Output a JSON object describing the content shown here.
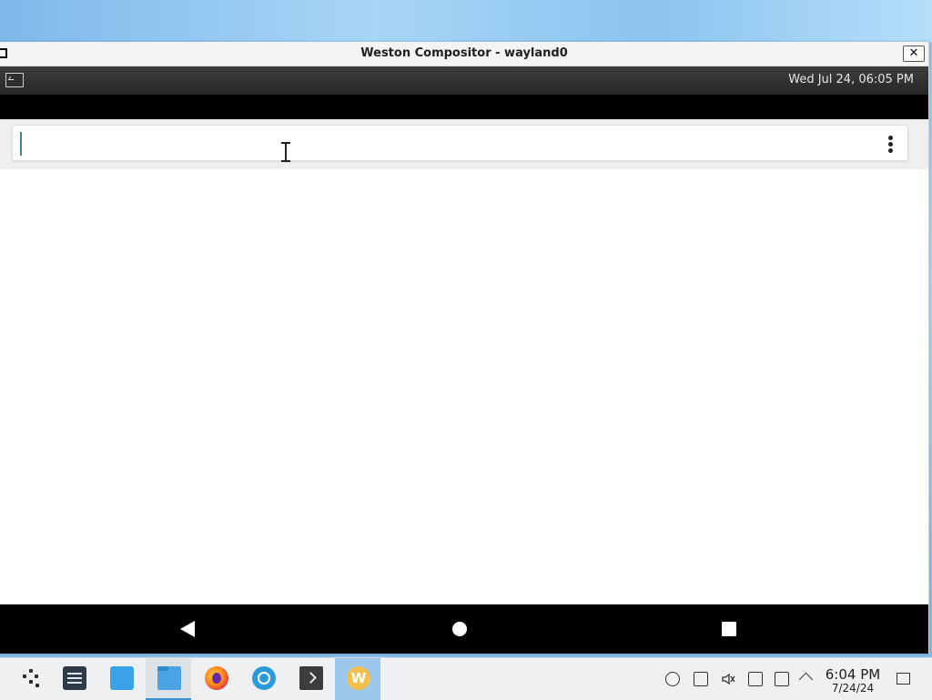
{
  "window": {
    "title": "Weston Compositor - wayland0",
    "close_glyph": "✕"
  },
  "weston_panel": {
    "clock": "Wed Jul 24, 06:05 PM"
  },
  "search": {
    "value": "",
    "placeholder": ""
  },
  "navigation": {
    "buttons": [
      "back",
      "home",
      "recents"
    ]
  },
  "taskbar": {
    "items": [
      {
        "icon": "app-launcher-icon",
        "state": "normal"
      },
      {
        "icon": "system-settings-icon",
        "state": "normal"
      },
      {
        "icon": "software-store-icon",
        "state": "normal"
      },
      {
        "icon": "file-manager-icon",
        "state": "active"
      },
      {
        "icon": "firefox-icon",
        "state": "normal"
      },
      {
        "icon": "browser-icon",
        "state": "normal"
      },
      {
        "icon": "terminal-icon",
        "state": "normal"
      },
      {
        "icon": "waydroid-icon",
        "state": "highlighted"
      }
    ],
    "tray_icons": [
      "updates-icon",
      "clipboard-icon",
      "volume-muted-icon",
      "storage-icon",
      "network-icon",
      "expand-tray-icon"
    ],
    "clock_time": "6:04 PM",
    "clock_date": "7/24/24",
    "waydroid_letter": "W"
  }
}
